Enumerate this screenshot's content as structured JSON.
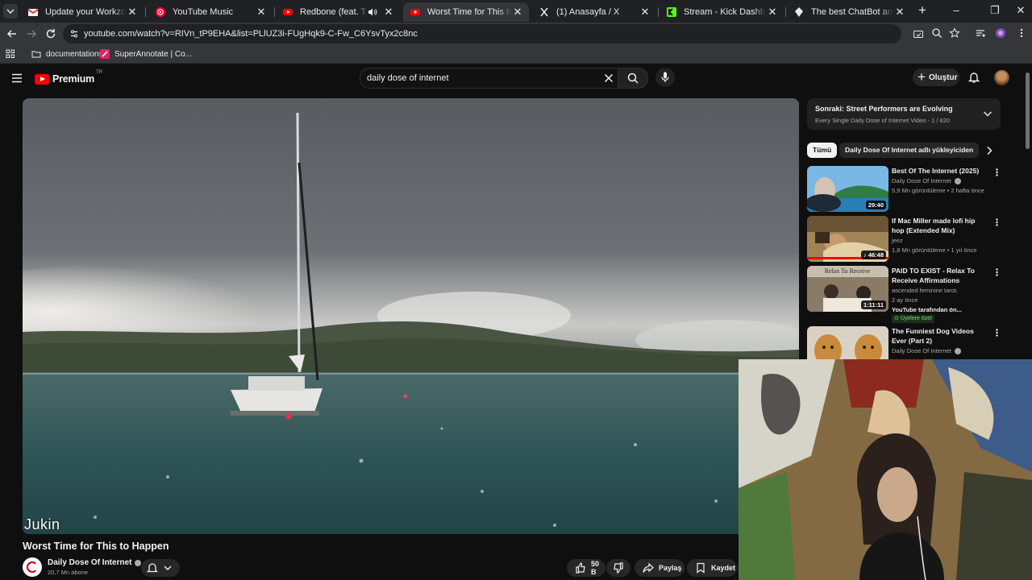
{
  "browser": {
    "tabs": [
      {
        "title": "Update your Workzone profile",
        "icon": "gmail-icon",
        "active": false
      },
      {
        "title": "YouTube Music",
        "icon": "youtube-music-icon",
        "active": false
      },
      {
        "title": "Redbone (feat. The Notoriou",
        "icon": "youtube-icon",
        "active": false,
        "audio": true
      },
      {
        "title": "Worst Time for This to Happen",
        "icon": "youtube-icon",
        "active": true
      },
      {
        "title": "(1) Anasayfa / X",
        "icon": "x-icon",
        "active": false
      },
      {
        "title": "Stream - Kick Dashboard",
        "icon": "kick-icon",
        "active": false
      },
      {
        "title": "The best ChatBot and Widgets",
        "icon": "chatbot-icon",
        "active": false
      }
    ],
    "url": "youtube.com/watch?v=RIVn_tP9EHA&list=PLlUZ3i-FUgHqk9-C-Fw_C6YsvTyx2c8nc",
    "bookmarks": [
      {
        "label": "documentations",
        "icon": "folder-icon"
      },
      {
        "label": "SuperAnnotate | Co...",
        "icon": "superannotate-icon"
      }
    ]
  },
  "youtube": {
    "logo_text": "Premium",
    "region": "TR",
    "search_value": "daily dose of internet",
    "create_label": "Oluştur",
    "video": {
      "watermark": "Jukin",
      "title": "Worst Time for This to Happen",
      "channel": "Daily Dose Of Internet",
      "subscribers": "20,7 Mn abone",
      "likes": "50 B",
      "share_label": "Paylaş",
      "save_label": "Kaydet"
    },
    "up_next": {
      "title": "Sonraki: Street Performers are Evolving",
      "subtitle": "Every Single Daily Dose of Internet Video - 1 / 820"
    },
    "chips": [
      "Tümü",
      "Daily Dose Of Internet adlı yükleyiciden"
    ],
    "recommendations": [
      {
        "title": "Best Of The Internet (2025)",
        "channel": "Daily Dose Of Internet",
        "verified": true,
        "meta": "5,9 Mn görüntüleme • 2 hafta önce",
        "duration": "29:40"
      },
      {
        "title": "If Mac Miller made lofi hip hop (Extended Mix)",
        "channel": "jeez",
        "verified": false,
        "meta": "1,8 Mn görüntüleme • 1 yıl önce",
        "duration": "46:48",
        "watched": 1.0
      },
      {
        "title": "PAID TO EXIST - Relax To Receive Affirmations",
        "channel": "ascended feminine tarot.",
        "verified": false,
        "meta": "2 ay önce",
        "extra": "YouTube tarafından ön...",
        "badge": "Üyelere özel",
        "duration": "1:11:11",
        "thumb_text": "Relax To Receive"
      },
      {
        "title": "The Funniest Dog Videos Ever (Part 2)",
        "channel": "Daily Dose Of Internet",
        "verified": true
      }
    ]
  }
}
